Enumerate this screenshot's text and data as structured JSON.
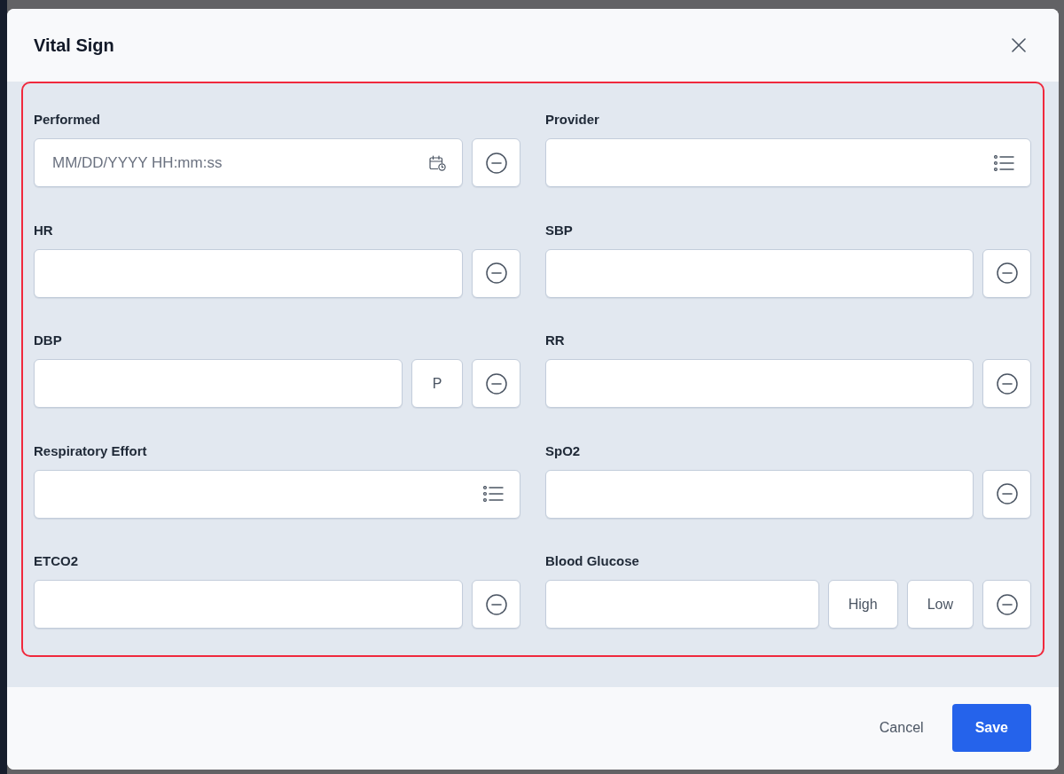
{
  "dialog": {
    "title": "Vital Sign"
  },
  "fields": [
    {
      "label": "Performed",
      "kind": "datetime",
      "placeholder": "MM/DD/YYYY HH:mm:ss",
      "addons": [
        {
          "kind": "remove"
        }
      ]
    },
    {
      "label": "Provider",
      "kind": "select"
    },
    {
      "label": "HR",
      "kind": "text",
      "addons": [
        {
          "kind": "remove"
        }
      ]
    },
    {
      "label": "SBP",
      "kind": "text",
      "addons": [
        {
          "kind": "remove"
        }
      ]
    },
    {
      "label": "DBP",
      "kind": "text",
      "addons": [
        {
          "kind": "option",
          "label": "P"
        },
        {
          "kind": "remove"
        }
      ]
    },
    {
      "label": "RR",
      "kind": "text",
      "addons": [
        {
          "kind": "remove"
        }
      ]
    },
    {
      "label": "Respiratory Effort",
      "kind": "select"
    },
    {
      "label": "SpO2",
      "kind": "text",
      "addons": [
        {
          "kind": "remove"
        }
      ]
    },
    {
      "label": "ETCO2",
      "kind": "text",
      "addons": [
        {
          "kind": "remove"
        }
      ]
    },
    {
      "label": "Blood Glucose",
      "kind": "text",
      "addons": [
        {
          "kind": "option",
          "label": "High"
        },
        {
          "kind": "option",
          "label": "Low"
        },
        {
          "kind": "remove"
        }
      ]
    }
  ],
  "footer": {
    "buttons": [
      {
        "label": "Cancel",
        "kind": "secondary"
      },
      {
        "label": "Save",
        "kind": "primary"
      }
    ]
  }
}
